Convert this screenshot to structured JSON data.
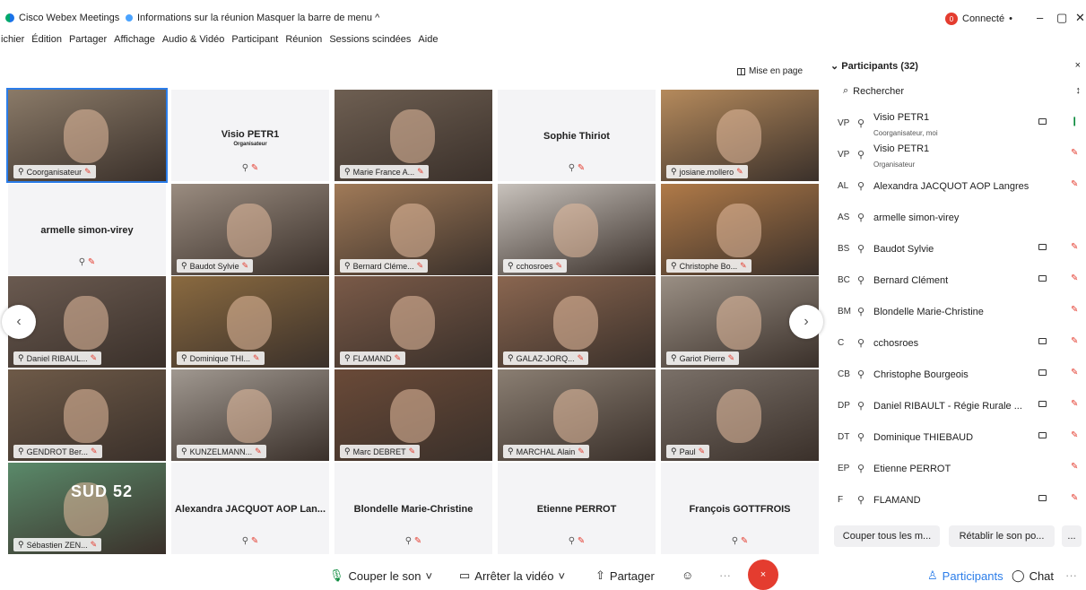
{
  "titlebar": {
    "app": "Cisco Webex Meetings",
    "info": "Informations sur la réunion",
    "hide": "Masquer la barre de menu ^",
    "connected": "Connecté",
    "conn_dot": "•",
    "badge": "0",
    "min": "–",
    "max": "▢",
    "close": "✕"
  },
  "menu": [
    "ichier",
    "Édition",
    "Partager",
    "Affichage",
    "Audio & Vidéo",
    "Participant",
    "Réunion",
    "Sessions scindées",
    "Aide"
  ],
  "layout_label": "Mise en page",
  "tiles": [
    {
      "label": "Coorganisateur",
      "video": true,
      "bg": "#8a7a68",
      "active": true
    },
    {
      "name": "Visio PETR1",
      "sub": "Organisateur",
      "video": false
    },
    {
      "label": "Marie France A...",
      "video": true,
      "bg": "#6e5f52"
    },
    {
      "name": "Sophie Thiriot",
      "video": false
    },
    {
      "label": "josiane.mollero",
      "video": true,
      "bg": "#b58a5c"
    },
    {
      "name": "armelle simon-virey",
      "video": false
    },
    {
      "label": "Baudot Sylvie",
      "video": true,
      "bg": "#9a8c80"
    },
    {
      "label": "Bernard Cléme...",
      "video": true,
      "bg": "#a07a58"
    },
    {
      "label": "cchosroes",
      "video": true,
      "bg": "#c8c2bc"
    },
    {
      "label": "Christophe Bo...",
      "video": true,
      "bg": "#b07a48"
    },
    {
      "label": "Daniel RIBAUL...",
      "video": true,
      "bg": "#6a5a50"
    },
    {
      "label": "Dominique THI...",
      "video": true,
      "bg": "#8a6a40"
    },
    {
      "label": "FLAMAND",
      "video": true,
      "bg": "#7a5a48"
    },
    {
      "label": "GALAZ-JORQ...",
      "video": true,
      "bg": "#8a6650"
    },
    {
      "label": "Gariot Pierre",
      "video": true,
      "bg": "#9a8f84"
    },
    {
      "label": "GENDROT Ber...",
      "video": true,
      "bg": "#6e5a48"
    },
    {
      "label": "KUNZELMANN...",
      "video": true,
      "bg": "#a09890"
    },
    {
      "label": "Marc DEBRET",
      "video": true,
      "bg": "#6a4a38"
    },
    {
      "label": "MARCHAL Alain",
      "video": true,
      "bg": "#8a7e72"
    },
    {
      "label": "Paul",
      "video": true,
      "bg": "#7a7068"
    },
    {
      "label": "Sébastien ZEN...",
      "video": true,
      "bg": "#5a8a6a",
      "banner": "SUD 52"
    },
    {
      "name": "Alexandra JACQUOT AOP Lan...",
      "video": false
    },
    {
      "name": "Blondelle Marie-Christine",
      "video": false
    },
    {
      "name": "Etienne PERROT",
      "video": false
    },
    {
      "name": "François GOTTFROIS",
      "video": false
    }
  ],
  "panel": {
    "title": "Participants (32)",
    "search": "Rechercher",
    "rows": [
      {
        "ini": "VP",
        "name": "Visio PETR1",
        "role": "Coorganisateur, moi",
        "cam": true,
        "mic": "on"
      },
      {
        "ini": "VP",
        "name": "Visio PETR1",
        "role": "Organisateur",
        "cam": false,
        "mic": "off"
      },
      {
        "ini": "AL",
        "name": "Alexandra JACQUOT AOP Langres",
        "cam": false,
        "mic": "off"
      },
      {
        "ini": "AS",
        "name": "armelle simon-virey",
        "cam": false,
        "mic": "none"
      },
      {
        "ini": "BS",
        "name": "Baudot Sylvie",
        "cam": true,
        "mic": "off"
      },
      {
        "ini": "BC",
        "name": "Bernard Clément",
        "cam": true,
        "mic": "off"
      },
      {
        "ini": "BM",
        "name": "Blondelle Marie-Christine",
        "cam": false,
        "mic": "off"
      },
      {
        "ini": "C",
        "name": "cchosroes",
        "cam": true,
        "mic": "off"
      },
      {
        "ini": "CB",
        "name": "Christophe Bourgeois",
        "cam": true,
        "mic": "off"
      },
      {
        "ini": "DP",
        "name": "Daniel RIBAULT - Régie Rurale ...",
        "cam": true,
        "mic": "off"
      },
      {
        "ini": "DT",
        "name": "Dominique THIEBAUD",
        "cam": true,
        "mic": "off"
      },
      {
        "ini": "EP",
        "name": "Etienne PERROT",
        "cam": false,
        "mic": "off"
      },
      {
        "ini": "F",
        "name": "FLAMAND",
        "cam": true,
        "mic": "off"
      }
    ],
    "mute_all": "Couper tous les m...",
    "unmute_all": "Rétablir le son po...",
    "more": "..."
  },
  "toolbar": {
    "mute": "Couper le son",
    "stop_video": "Arrêter la vidéo",
    "share": "Partager",
    "participants": "Participants",
    "chat": "Chat",
    "end": "×",
    "more": "···"
  }
}
